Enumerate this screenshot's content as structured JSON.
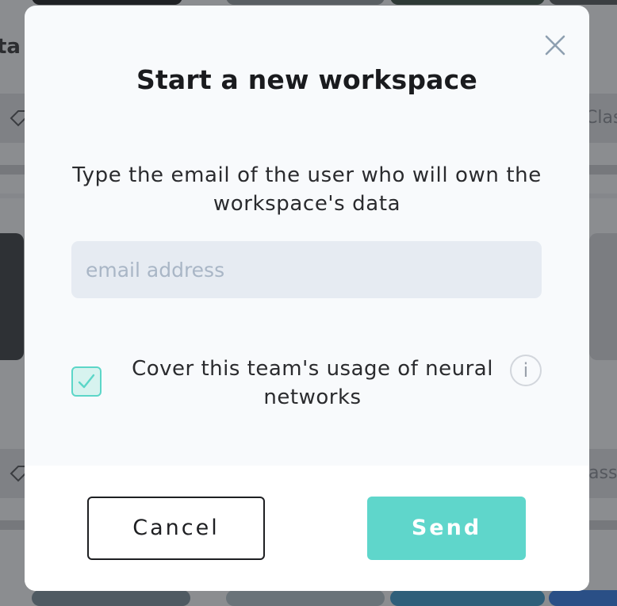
{
  "background": {
    "heading_fragment": "ta",
    "tag_fragment_left_top": "",
    "tag_fragment_right_top": "Clas",
    "tag_fragment_right_bottom": "ass"
  },
  "modal": {
    "title": "Start a new workspace",
    "instruction": "Type the email of the user who will own the workspace's data",
    "email_input": {
      "value": "",
      "placeholder": "email address"
    },
    "checkbox": {
      "checked": true,
      "label": "Cover this team's usage of neural networks"
    },
    "info_icon_glyph": "i",
    "buttons": {
      "cancel": "Cancel",
      "send": "Send"
    }
  },
  "colors": {
    "accent": "#5fd6cb",
    "checkbox_fill": "#d7f3ef",
    "input_bg": "#e6ebf2",
    "overlay": "#8b8d90"
  }
}
